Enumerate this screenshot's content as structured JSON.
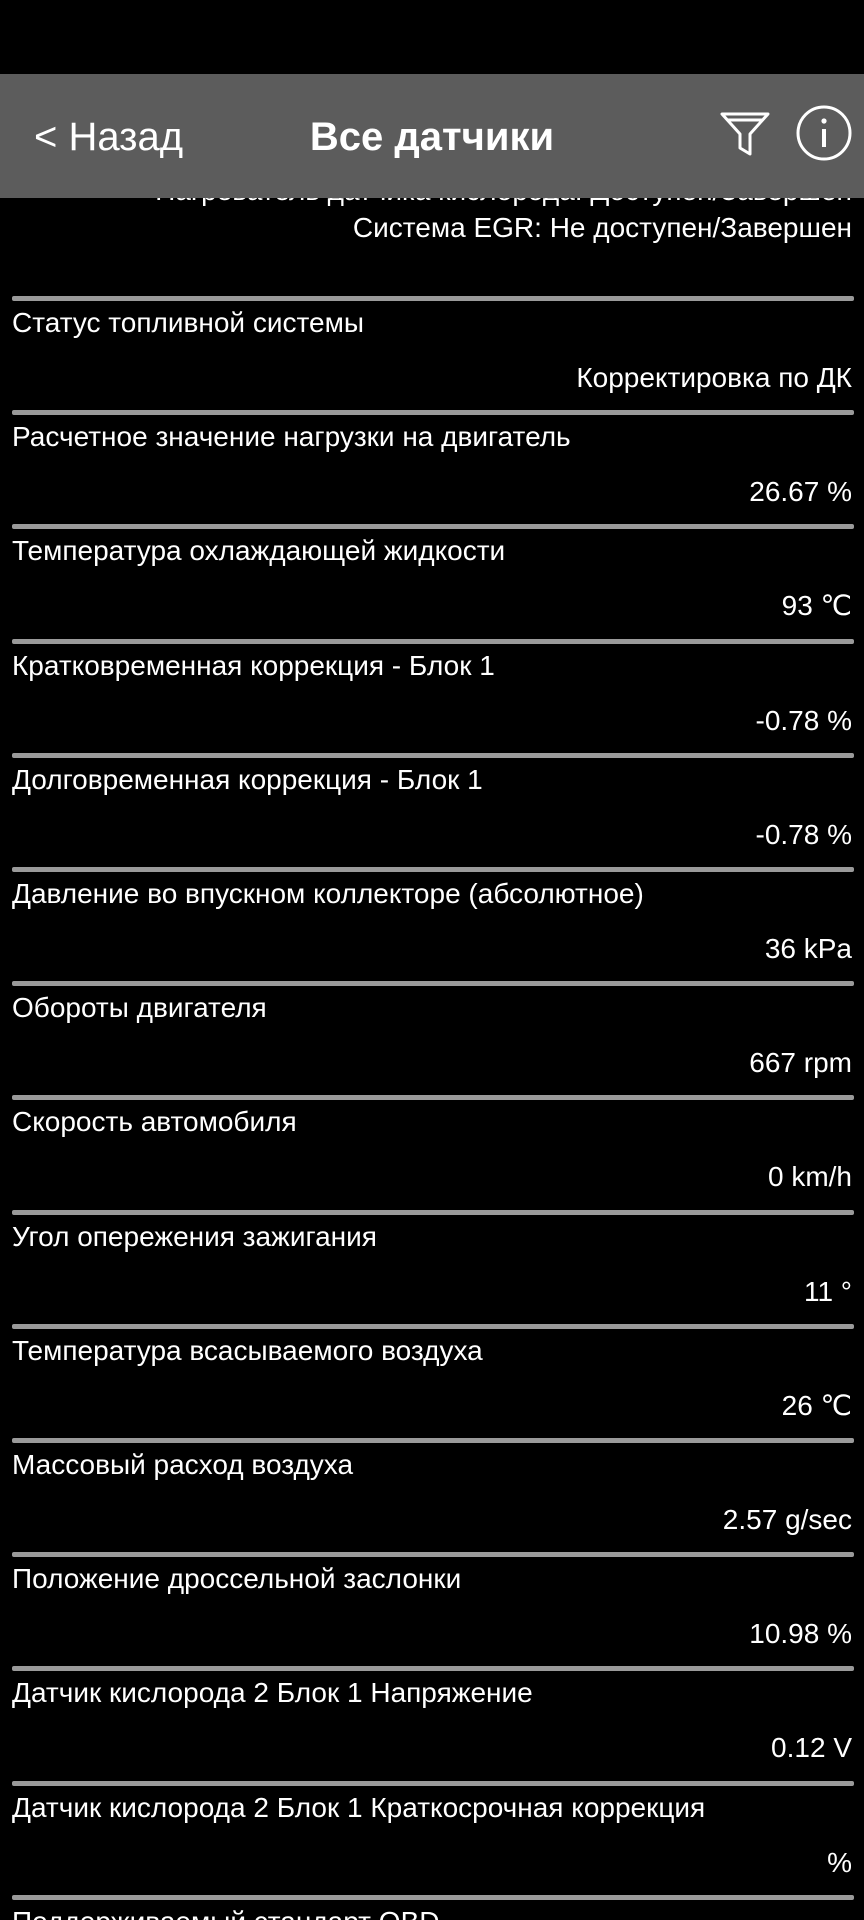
{
  "header": {
    "back_label": "< Назад",
    "title": "Все датчики",
    "filter_icon": "filter-icon",
    "info_icon": "info-icon"
  },
  "previous_item": {
    "lines": [
      "Нагреватель датчика кислорода: Доступен/Завершен",
      "Система EGR: Не доступен/Завершен"
    ]
  },
  "sensors": [
    {
      "label": "Статус топливной системы",
      "value": "Корректировка по ДК"
    },
    {
      "label": "Расчетное значение нагрузки на двигатель",
      "value": "26.67 %"
    },
    {
      "label": "Температура охлаждающей жидкости",
      "value": "93 ℃"
    },
    {
      "label": "Кратковременная коррекция - Блок 1",
      "value": "-0.78 %"
    },
    {
      "label": "Долговременная коррекция - Блок 1",
      "value": "-0.78 %"
    },
    {
      "label": "Давление во впускном коллекторе (абсолютное)",
      "value": "36 kPa"
    },
    {
      "label": "Обороты двигателя",
      "value": "667 rpm"
    },
    {
      "label": "Скорость автомобиля",
      "value": "0 km/h"
    },
    {
      "label": "Угол опережения зажигания",
      "value": "11 °"
    },
    {
      "label": "Температура всасываемого воздуха",
      "value": "26 ℃"
    },
    {
      "label": "Массовый расход воздуха",
      "value": "2.57 g/sec"
    },
    {
      "label": "Положение дроссельной заслонки",
      "value": "10.98 %"
    },
    {
      "label": "Датчик кислорода 2 Блок 1 Напряжение",
      "value": "0.12 V"
    },
    {
      "label": "Датчик кислорода 2 Блок 1 Краткосрочная коррекция",
      "value": "%"
    },
    {
      "label": "Поддерживаемый стандарт OBD",
      "value": ""
    }
  ]
}
